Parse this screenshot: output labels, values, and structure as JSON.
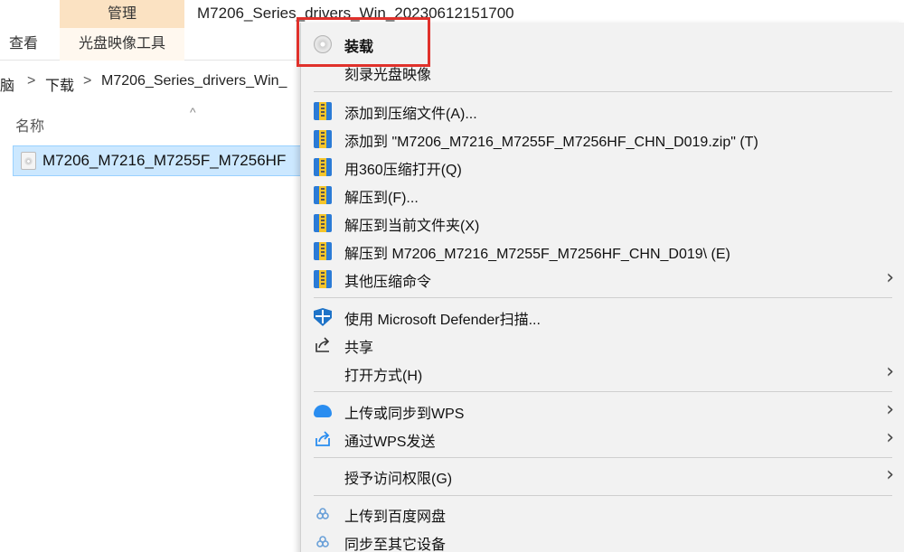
{
  "window": {
    "context_tab": "管理",
    "title": "M7206_Series_drivers_Win_20230612151700"
  },
  "ribbon": {
    "tab_view": "查看",
    "tab_disc_tools": "光盘映像工具"
  },
  "address": {
    "crumb_pc": "脑",
    "crumb_downloads": "下载",
    "crumb_folder": "M7206_Series_drivers_Win_",
    "separator": ">"
  },
  "file_list": {
    "column_name": "名称",
    "sort_arrow": "^",
    "selected_file": "M7206_M7216_M7255F_M7256HF"
  },
  "context_menu": {
    "highlight_color": "#e0312b",
    "items": [
      {
        "label": "装载",
        "icon": "disc-icon"
      },
      {
        "label": "刻录光盘映像",
        "icon": ""
      },
      {
        "label": "添加到压缩文件(A)...",
        "icon": "winrar-icon"
      },
      {
        "label": "添加到 \"M7206_M7216_M7255F_M7256HF_CHN_D019.zip\" (T)",
        "icon": "winrar-icon"
      },
      {
        "label": "用360压缩打开(Q)",
        "icon": "winrar-icon"
      },
      {
        "label": "解压到(F)...",
        "icon": "winrar-icon"
      },
      {
        "label": "解压到当前文件夹(X)",
        "icon": "winrar-icon"
      },
      {
        "label": "解压到 M7206_M7216_M7255F_M7256HF_CHN_D019\\ (E)",
        "icon": "winrar-icon"
      },
      {
        "label": "其他压缩命令",
        "icon": "winrar-icon",
        "submenu": true
      },
      {
        "label": "使用 Microsoft Defender扫描...",
        "icon": "defender-shield-icon"
      },
      {
        "label": "共享",
        "icon": "share-icon"
      },
      {
        "label": "打开方式(H)",
        "icon": "",
        "submenu": true
      },
      {
        "label": "上传或同步到WPS",
        "icon": "cloud-icon",
        "submenu": true
      },
      {
        "label": "通过WPS发送",
        "icon": "send-icon",
        "submenu": true
      },
      {
        "label": "授予访问权限(G)",
        "icon": "",
        "submenu": true
      },
      {
        "label": "上传到百度网盘",
        "icon": "baidu-netdisk-icon"
      },
      {
        "label": "同步至其它设备",
        "icon": "baidu-netdisk-icon"
      }
    ],
    "chevron": "›"
  }
}
